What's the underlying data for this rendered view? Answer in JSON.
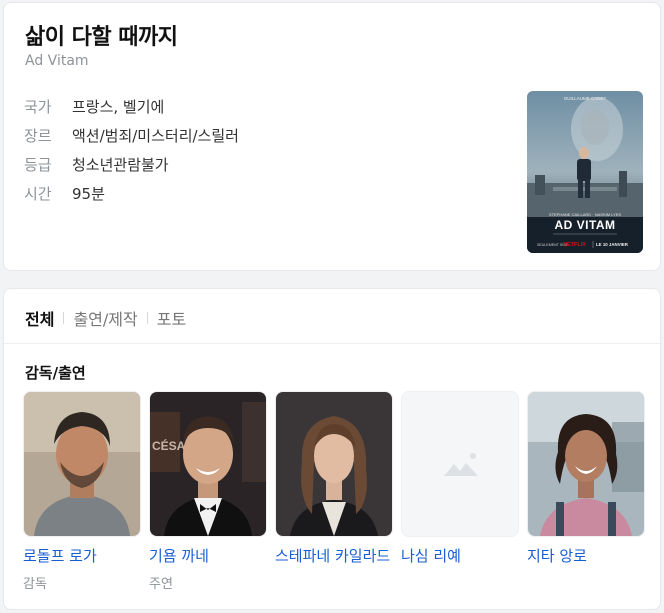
{
  "movie": {
    "title": "삶이 다할 때까지",
    "original_title": "Ad Vitam",
    "info": [
      {
        "key": "국가",
        "value": "프랑스, 벨기에"
      },
      {
        "key": "장르",
        "value": "액션/범죄/미스터리/스릴러"
      },
      {
        "key": "등급",
        "value": "청소년관람불가"
      },
      {
        "key": "시간",
        "value": "95분"
      }
    ],
    "poster": {
      "title_text": "AD VITAM",
      "top_text": "GUILLAUME CANET",
      "bottom_left": "SEULEMENT SUR",
      "brand": "NETFLIX",
      "date": "LE 10 JANVIER"
    }
  },
  "tabs": [
    {
      "label": "전체",
      "active": true
    },
    {
      "label": "출연/제작",
      "active": false
    },
    {
      "label": "포토",
      "active": false
    }
  ],
  "cast_section": {
    "label": "감독/출연",
    "people": [
      {
        "name": "로돌프 로가",
        "role": "감독"
      },
      {
        "name": "기욤 까네",
        "role": "주연"
      },
      {
        "name": "스테파네 카일라드",
        "role": ""
      },
      {
        "name": "나심 리예",
        "role": ""
      },
      {
        "name": "지타 앙로",
        "role": ""
      }
    ]
  },
  "colors": {
    "link": "#1a5ed4",
    "muted": "#8e939a",
    "netflix": "#e50914"
  }
}
